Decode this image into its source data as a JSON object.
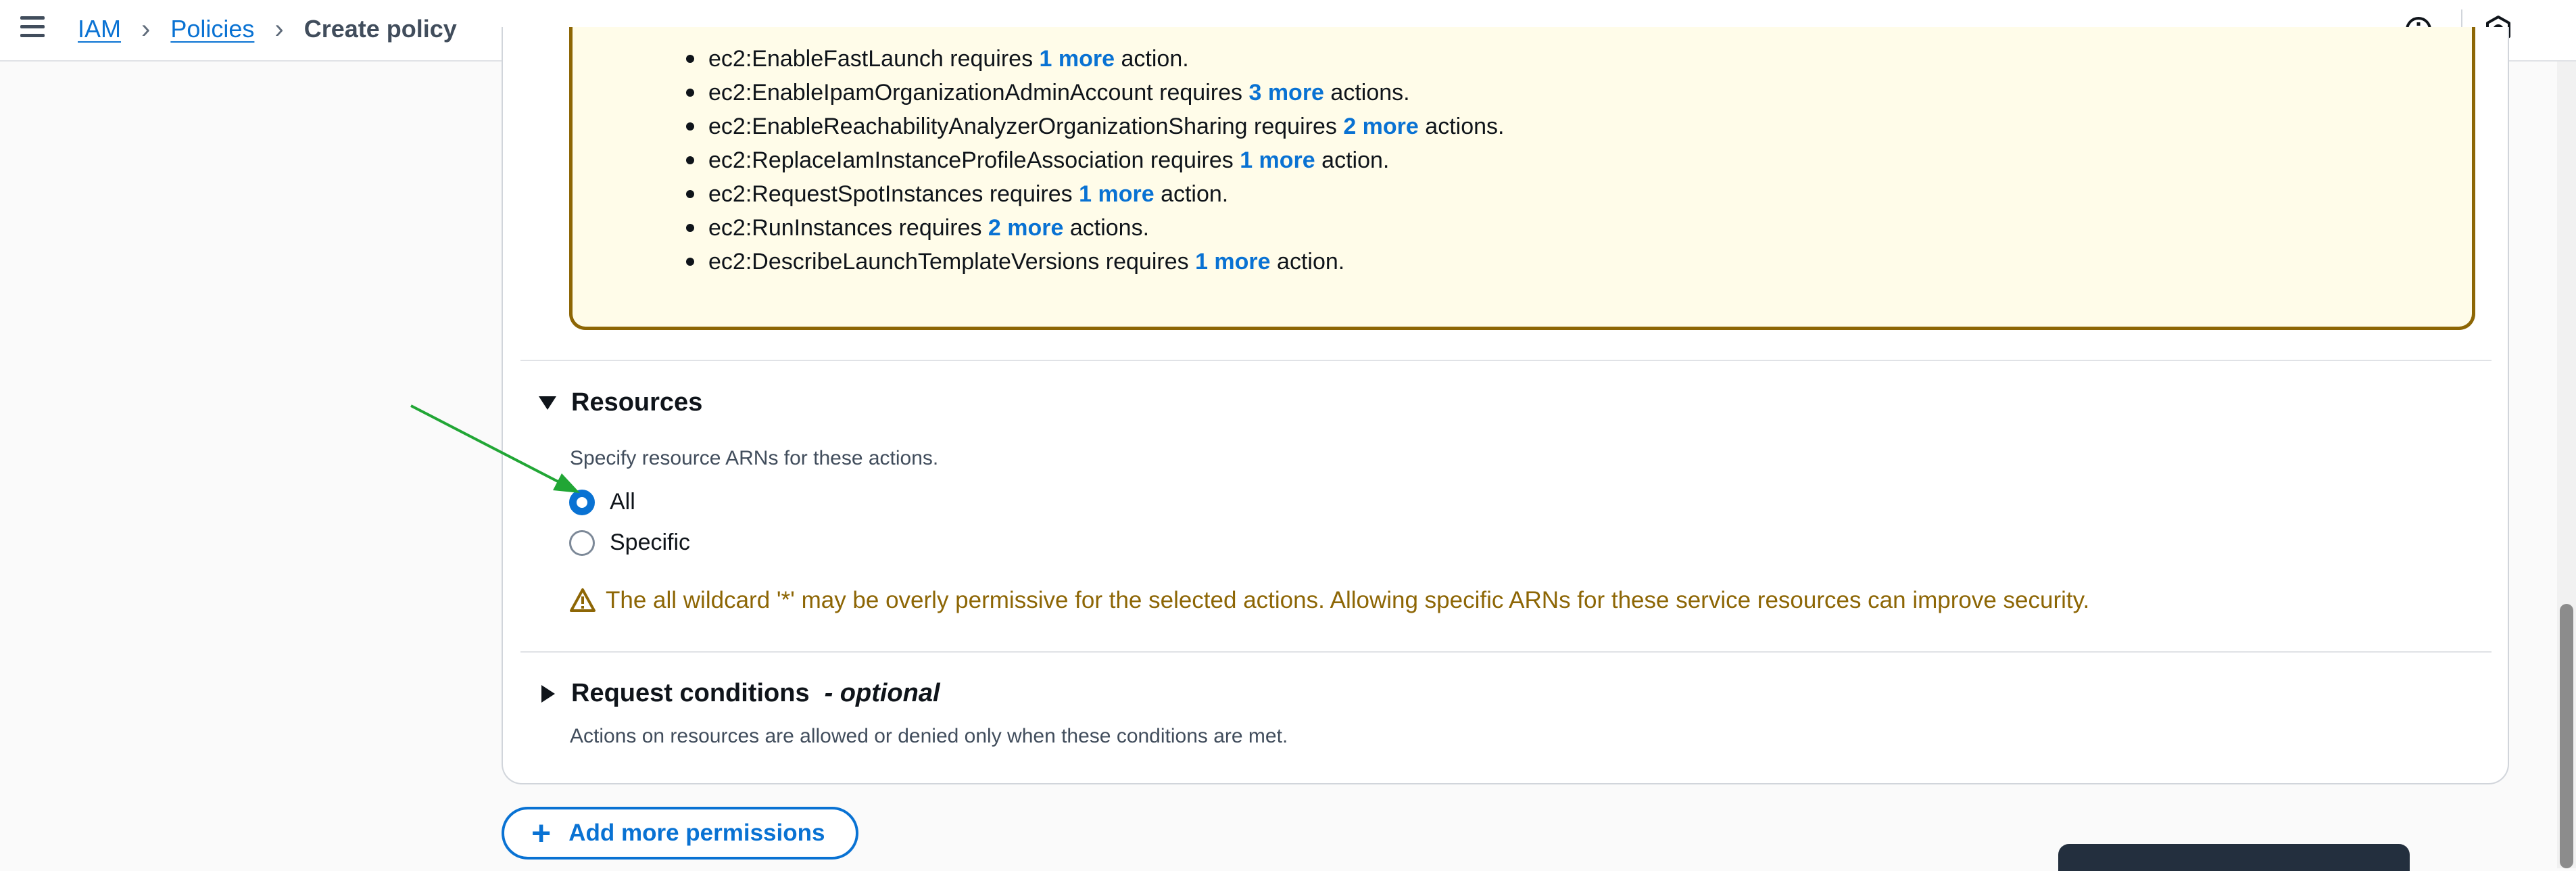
{
  "breadcrumb": {
    "items": [
      "IAM",
      "Policies"
    ],
    "current": "Create policy"
  },
  "icons": {
    "menu": "hamburger-icon",
    "info": "info-icon",
    "settings": "hexagon-settings-icon",
    "warning": "warning-triangle-icon",
    "add": "plus-icon"
  },
  "warning_list": [
    {
      "action": "ec2:EnableFastLaunch requires",
      "more": "1 more",
      "suffix": "action."
    },
    {
      "action": "ec2:EnableIpamOrganizationAdminAccount requires",
      "more": "3 more",
      "suffix": "actions."
    },
    {
      "action": "ec2:EnableReachabilityAnalyzerOrganizationSharing requires",
      "more": "2 more",
      "suffix": "actions."
    },
    {
      "action": "ec2:ReplaceIamInstanceProfileAssociation requires",
      "more": "1 more",
      "suffix": "action."
    },
    {
      "action": "ec2:RequestSpotInstances requires",
      "more": "1 more",
      "suffix": "action."
    },
    {
      "action": "ec2:RunInstances requires",
      "more": "2 more",
      "suffix": "actions."
    },
    {
      "action": "ec2:DescribeLaunchTemplateVersions requires",
      "more": "1 more",
      "suffix": "action."
    }
  ],
  "resources": {
    "title": "Resources",
    "description": "Specify resource ARNs for these actions.",
    "options": [
      "All",
      "Specific"
    ],
    "selected": "All",
    "wildcard_warning": "The all wildcard '*' may be overly permissive for the selected actions. Allowing specific ARNs for these service resources can improve security."
  },
  "request_conditions": {
    "title": "Request conditions",
    "optional": "- optional",
    "description": "Actions on resources are allowed or denied only when these conditions are met."
  },
  "add_permissions_label": "Add more permissions",
  "colors": {
    "link": "#0972d3",
    "warning_text": "#8d6605",
    "warning_bg": "#fffce9",
    "annotation_arrow": "#21a635"
  }
}
